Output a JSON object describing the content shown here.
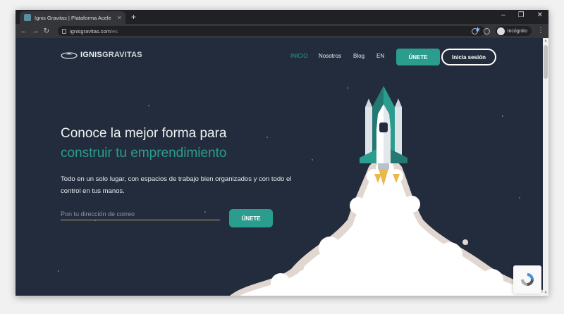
{
  "browser": {
    "tab_title": "Ignis Gravitas | Plataforma Acele",
    "tab_close": "×",
    "new_tab": "+",
    "url_domain": "ignisgravitas.com",
    "url_path": "/es",
    "incognito_label": "Incógnito",
    "minimize": "–",
    "restore": "❐",
    "close": "✕"
  },
  "site": {
    "brand_part1": "IGNIS",
    "brand_part2": "GRAVITAS",
    "nav": [
      {
        "label": "INICIO"
      },
      {
        "label": "Nosotros"
      },
      {
        "label": "Blog"
      },
      {
        "label": "EN"
      }
    ],
    "join_button": "ÚNETE",
    "login_button": "Inicia sesión"
  },
  "hero": {
    "headline_line1": "Conoce la mejor forma para",
    "headline_line2": "construir tu emprendimiento",
    "description": "Todo en un solo lugar, con espacios de trabajo bien organizados y con todo el control en tus manos.",
    "email_placeholder": "Pon tu dirección de correo",
    "cta_button": "ÚNETE"
  },
  "colors": {
    "background": "#232c3c",
    "accent": "#2a9d8f",
    "underline": "#c9a969"
  }
}
